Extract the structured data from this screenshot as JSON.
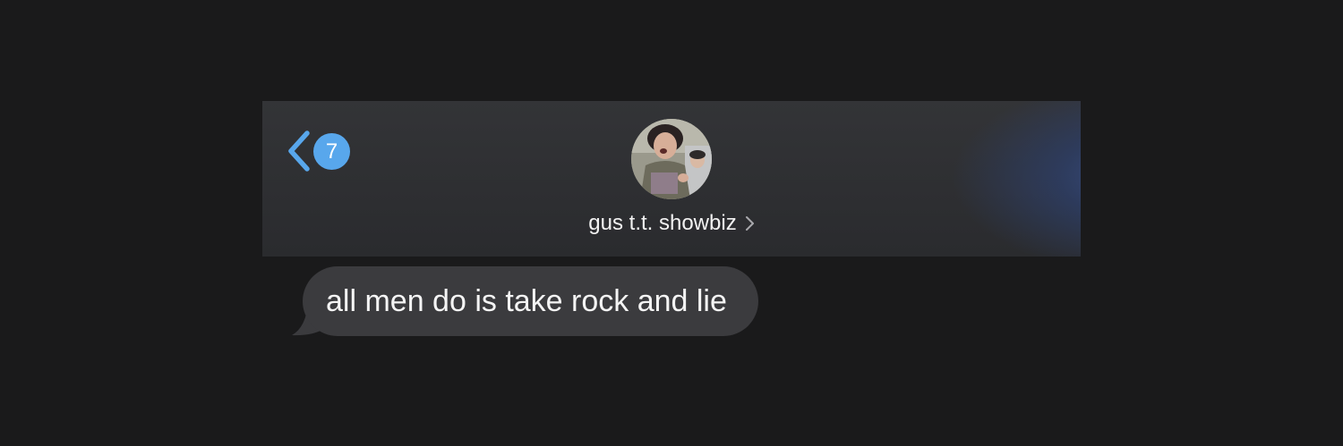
{
  "header": {
    "unread_count": "7",
    "contact_name": "gus t.t. showbiz"
  },
  "icons": {
    "back": "chevron-left-icon",
    "contact_details": "chevron-right-icon"
  },
  "colors": {
    "background": "#1a1a1b",
    "header_background": "#2f3033",
    "accent": "#58a7ec",
    "bubble": "#3b3b3e",
    "text": "#f4f4f4"
  },
  "messages": [
    {
      "direction": "received",
      "text": "all men do is take rock and lie"
    }
  ]
}
